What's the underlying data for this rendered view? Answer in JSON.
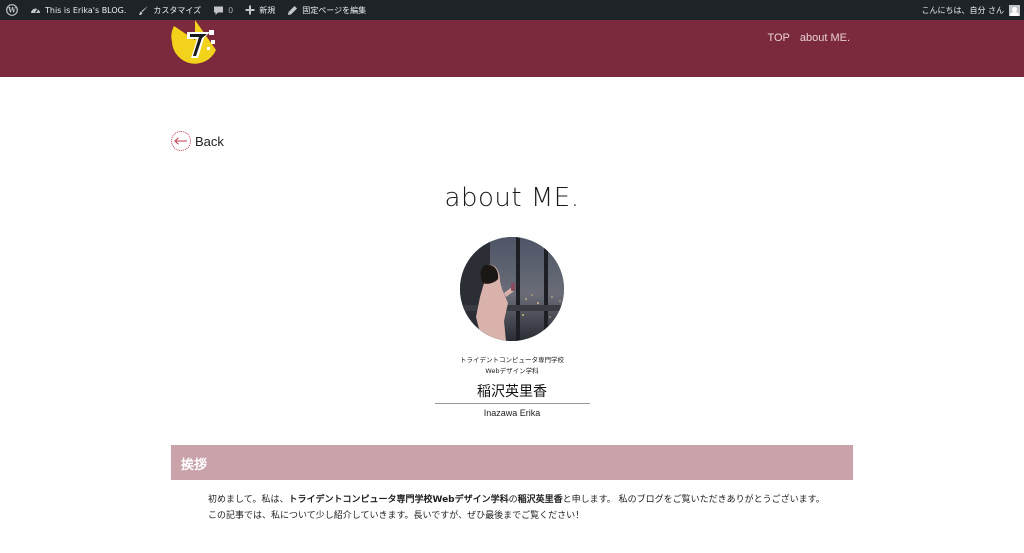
{
  "admin_bar": {
    "site_name": "This is Erika's BLOG.",
    "customize": "カスタマイズ",
    "comment_count": "0",
    "new": "新規",
    "edit_page": "固定ページを編集",
    "greeting": "こんにちは、自分 さん"
  },
  "nav": {
    "items": [
      "TOP",
      "about ME."
    ]
  },
  "back_label": "Back",
  "page_title": "about ME.",
  "profile": {
    "school": "トライデントコンピュータ専門学校",
    "department": "Webデザイン学科",
    "name_jp": "稲沢英里香",
    "name_en": "Inazawa Erika"
  },
  "greeting_section": {
    "title": "挨拶",
    "p1_a": "初めまして。私は、",
    "p1_b": "トライデントコンピュータ専門学校Webデザイン学科",
    "p1_c": "の",
    "p1_d": "稲沢英里香",
    "p1_e": "と申します。 私のブログをご覧いただきありがとうございます。",
    "p2": "この記事では、私について少し紹介していきます。長いですが、ぜひ最後までご覧ください！"
  },
  "colors": {
    "admin_bar": "#1d2327",
    "header": "#7a2a3c",
    "section_bar": "#c9a2aa",
    "logo_yellow": "#f3d21b"
  }
}
